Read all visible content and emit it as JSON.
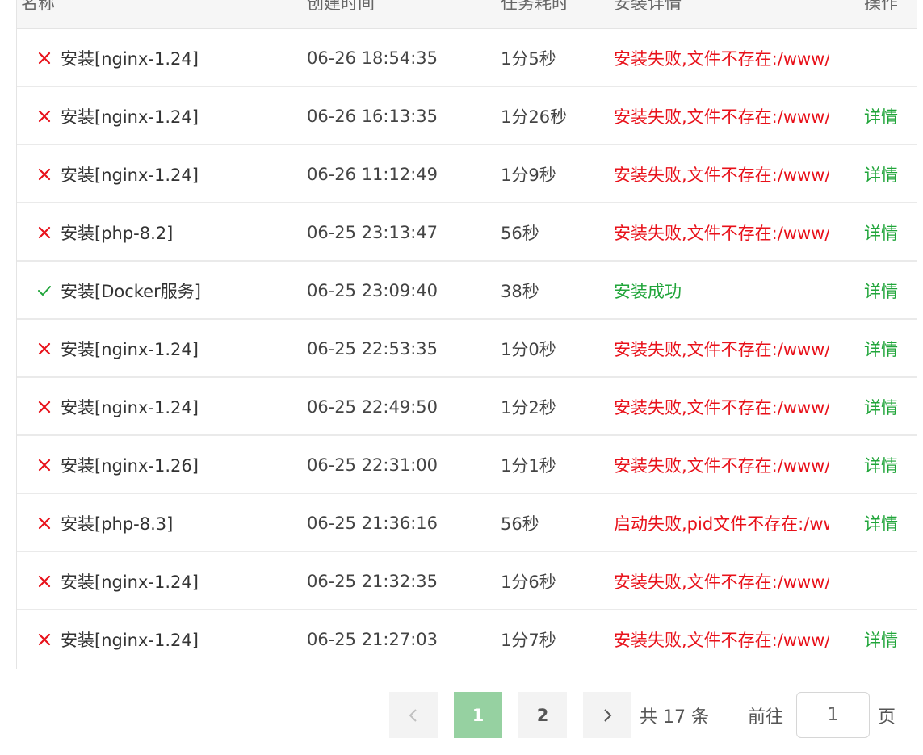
{
  "table": {
    "headers": [
      "名称",
      "创建时间",
      "任务耗时",
      "安装详情",
      "操作"
    ],
    "rows": [
      {
        "status": "fail",
        "name": "安装[nginx-1.24]",
        "time": "06-26 18:54:35",
        "duration": "1分5秒",
        "detail": "安装失败,文件不存在:/www/server/nginx",
        "op": ""
      },
      {
        "status": "fail",
        "name": "安装[nginx-1.24]",
        "time": "06-26 16:13:35",
        "duration": "1分26秒",
        "detail": "安装失败,文件不存在:/www/server/nginx",
        "op": "详情"
      },
      {
        "status": "fail",
        "name": "安装[nginx-1.24]",
        "time": "06-26 11:12:49",
        "duration": "1分9秒",
        "detail": "安装失败,文件不存在:/www/server/nginx",
        "op": "详情"
      },
      {
        "status": "fail",
        "name": "安装[php-8.2]",
        "time": "06-25 23:13:47",
        "duration": "56秒",
        "detail": "安装失败,文件不存在:/www/server/php",
        "op": "详情"
      },
      {
        "status": "ok",
        "name": "安装[Docker服务]",
        "time": "06-25 23:09:40",
        "duration": "38秒",
        "detail": "安装成功",
        "op": "详情"
      },
      {
        "status": "fail",
        "name": "安装[nginx-1.24]",
        "time": "06-25 22:53:35",
        "duration": "1分0秒",
        "detail": "安装失败,文件不存在:/www/server/nginx",
        "op": "详情"
      },
      {
        "status": "fail",
        "name": "安装[nginx-1.24]",
        "time": "06-25 22:49:50",
        "duration": "1分2秒",
        "detail": "安装失败,文件不存在:/www/server/nginx",
        "op": "详情"
      },
      {
        "status": "fail",
        "name": "安装[nginx-1.26]",
        "time": "06-25 22:31:00",
        "duration": "1分1秒",
        "detail": "安装失败,文件不存在:/www/server/nginx",
        "op": "详情"
      },
      {
        "status": "fail",
        "name": "安装[php-8.3]",
        "time": "06-25 21:36:16",
        "duration": "56秒",
        "detail": "启动失败,pid文件不存在:/www/server/php",
        "op": "详情"
      },
      {
        "status": "fail",
        "name": "安装[nginx-1.24]",
        "time": "06-25 21:32:35",
        "duration": "1分6秒",
        "detail": "安装失败,文件不存在:/www/server/nginx",
        "op": ""
      },
      {
        "status": "fail",
        "name": "安装[nginx-1.24]",
        "time": "06-25 21:27:03",
        "duration": "1分7秒",
        "detail": "安装失败,文件不存在:/www/server/nginx",
        "op": "详情"
      }
    ]
  },
  "pagination": {
    "prev_icon": "chevron-left-icon",
    "next_icon": "chevron-right-icon",
    "pages": [
      "1",
      "2"
    ],
    "current_page": "1",
    "total_text": "共 17 条",
    "goto_label": "前往",
    "goto_value": "1",
    "page_suffix": "页"
  },
  "colors": {
    "fail": "#e8111a",
    "success": "#20a53a",
    "active_page": "#96d1a1"
  }
}
